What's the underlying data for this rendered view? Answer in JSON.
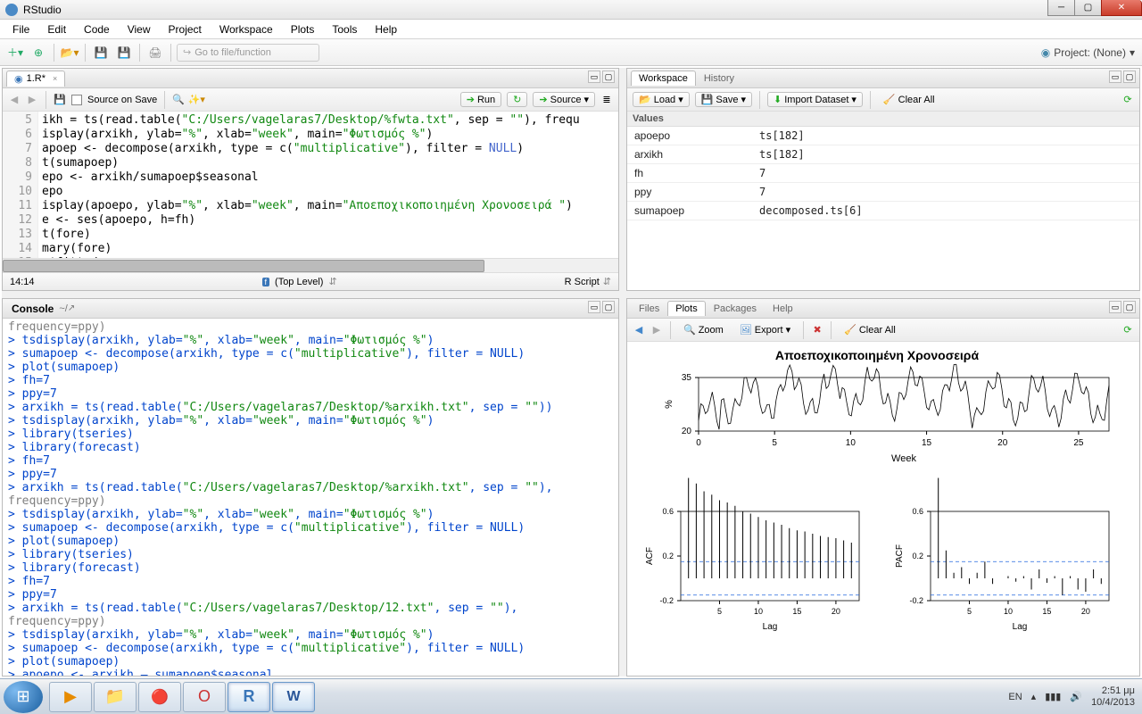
{
  "window_title": "RStudio",
  "menu": [
    "File",
    "Edit",
    "Code",
    "View",
    "Project",
    "Workspace",
    "Plots",
    "Tools",
    "Help"
  ],
  "toolbar": {
    "new": "●",
    "open": "📁",
    "save": "💾",
    "saveall": "💾",
    "print": "🖨",
    "goto": "⟲",
    "goto_placeholder": "Go to file/function",
    "project_label": "Project: (None)"
  },
  "source": {
    "tab_name": "1.R*",
    "source_on_save": "Source on Save",
    "run": "Run",
    "rerun": "⟳",
    "source_btn": "Source",
    "lines_start": 5,
    "lines": [
      "ikh = ts(read.table(\"C:/Users/vagelaras7/Desktop/%fwta.txt\", sep = \"\"), frequ",
      "isplay(arxikh, ylab=\"%\", xlab=\"week\", main=\"Φωτισμός %\")",
      "apoep <- decompose(arxikh, type = c(\"multiplicative\"), filter = NULL)",
      "t(sumapoep)",
      "epo <- arxikh/sumapoep$seasonal",
      "epo",
      "isplay(apoepo, ylab=\"%\", xlab=\"week\", main=\"Αποεποχικοποιημένη Χρονοσειρά \")",
      "e <- ses(apoepo, h=fh)",
      "t(fore)",
      "mary(fore)",
      "e$fitted",
      ""
    ],
    "cursor": "14:14",
    "scope": "(Top Level)",
    "lang": "R Script"
  },
  "console": {
    "label": "Console",
    "path": "~/",
    "lines": [
      {
        "t": "frequency=ppy)",
        "c": "gray"
      },
      {
        "t": "> tsdisplay(arxikh, ylab=\"%\", xlab=\"week\", main=\"Φωτισμός %\")"
      },
      {
        "t": "> sumapoep <- decompose(arxikh, type = c(\"multiplicative\"), filter = NULL)"
      },
      {
        "t": "> plot(sumapoep)"
      },
      {
        "t": "> fh=7"
      },
      {
        "t": "> ppy=7"
      },
      {
        "t": "> arxikh = ts(read.table(\"C:/Users/vagelaras7/Desktop/%arxikh.txt\", sep = \"\"))"
      },
      {
        "t": "> tsdisplay(arxikh, ylab=\"%\", xlab=\"week\", main=\"Φωτισμός %\")"
      },
      {
        "t": "> library(tseries)"
      },
      {
        "t": "> library(forecast)"
      },
      {
        "t": "> fh=7"
      },
      {
        "t": "> ppy=7"
      },
      {
        "t": "> arxikh = ts(read.table(\"C:/Users/vagelaras7/Desktop/%arxikh.txt\", sep = \"\"),"
      },
      {
        "t": "frequency=ppy)",
        "c": "gray"
      },
      {
        "t": "> tsdisplay(arxikh, ylab=\"%\", xlab=\"week\", main=\"Φωτισμός %\")"
      },
      {
        "t": "> sumapoep <- decompose(arxikh, type = c(\"multiplicative\"), filter = NULL)"
      },
      {
        "t": "> plot(sumapoep)"
      },
      {
        "t": "> library(tseries)"
      },
      {
        "t": "> library(forecast)"
      },
      {
        "t": "> fh=7"
      },
      {
        "t": "> ppy=7"
      },
      {
        "t": "> arxikh = ts(read.table(\"C:/Users/vagelaras7/Desktop/12.txt\", sep = \"\"),"
      },
      {
        "t": "frequency=ppy)",
        "c": "gray"
      },
      {
        "t": "> tsdisplay(arxikh, ylab=\"%\", xlab=\"week\", main=\"Φωτισμός %\")"
      },
      {
        "t": "> sumapoep <- decompose(arxikh, type = c(\"multiplicative\"), filter = NULL)"
      },
      {
        "t": "> plot(sumapoep)"
      },
      {
        "t": "> apoepo <- arxikh – sumapoep$seasonal"
      }
    ]
  },
  "workspace": {
    "tab1": "Workspace",
    "tab2": "History",
    "load": "Load",
    "save": "Save",
    "import": "Import Dataset",
    "clear": "Clear All",
    "section": "Values",
    "vars": [
      {
        "name": "apoepo",
        "val": "ts[182]"
      },
      {
        "name": "arxikh",
        "val": "ts[182]"
      },
      {
        "name": "fh",
        "val": "7"
      },
      {
        "name": "ppy",
        "val": "7"
      },
      {
        "name": "sumapoep",
        "val": "decomposed.ts[6]"
      }
    ]
  },
  "plots": {
    "tabs": [
      "Files",
      "Plots",
      "Packages",
      "Help"
    ],
    "active": 1,
    "back": "◀",
    "fwd": "▶",
    "zoom": "Zoom",
    "export": "Export",
    "del": "✖",
    "clear": "Clear All"
  },
  "chart_data": {
    "type": "tsdisplay",
    "title": "Αποεποχικοποιημένη Χρονοσειρά",
    "top": {
      "xlabel": "Week",
      "ylabel": "%",
      "xticks": [
        0,
        5,
        10,
        15,
        20,
        25
      ],
      "yticks": [
        20,
        35
      ],
      "x_range": [
        0,
        27
      ],
      "series": "noisy line oscillating between ~22 and ~36"
    },
    "acf": {
      "ylabel": "ACF",
      "xlabel": "Lag",
      "xticks": [
        5,
        10,
        15,
        20
      ],
      "yticks": [
        -0.2,
        0.2,
        0.6
      ],
      "values": [
        0.9,
        0.85,
        0.78,
        0.75,
        0.7,
        0.68,
        0.65,
        0.6,
        0.58,
        0.55,
        0.52,
        0.5,
        0.48,
        0.45,
        0.43,
        0.42,
        0.4,
        0.38,
        0.37,
        0.36,
        0.34,
        0.32
      ]
    },
    "pacf": {
      "ylabel": "PACF",
      "xlabel": "Lag",
      "xticks": [
        5,
        10,
        15,
        20
      ],
      "yticks": [
        -0.2,
        0.2,
        0.6
      ],
      "values": [
        0.9,
        0.25,
        0.05,
        0.1,
        -0.05,
        0.05,
        0.15,
        -0.05,
        0,
        0.02,
        -0.03,
        0.02,
        -0.1,
        0.08,
        -0.04,
        0.02,
        -0.15,
        0.02,
        -0.1,
        -0.12,
        0.08,
        -0.05
      ]
    }
  },
  "taskbar": {
    "lang": "EN",
    "time": "2:51 μμ",
    "date": "10/4/2013"
  }
}
